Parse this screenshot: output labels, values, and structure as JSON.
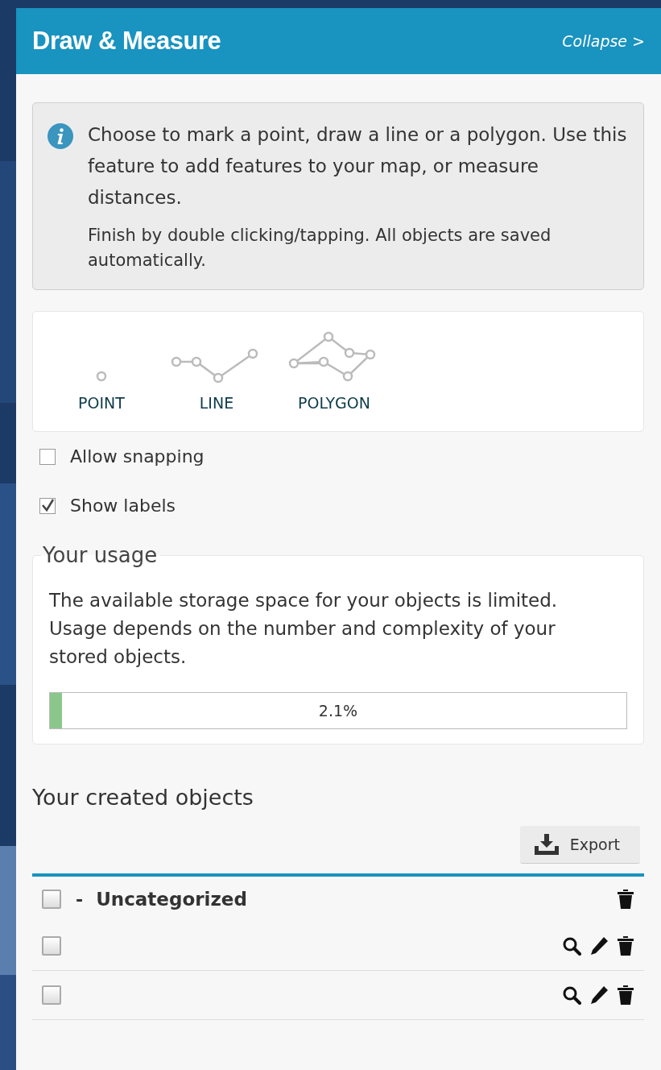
{
  "panel": {
    "title": "Draw & Measure",
    "collapse_link": "Collapse >"
  },
  "info": {
    "paragraphs": [
      "Choose to mark a point, draw a line or a polygon. Use this feature to add features to your map, or measure distances.",
      "Finish by double clicking/tapping. All objects are saved automatically."
    ]
  },
  "tools": [
    {
      "kind": "point",
      "label": "POINT"
    },
    {
      "kind": "line",
      "label": "LINE"
    },
    {
      "kind": "polygon",
      "label": "POLYGON"
    }
  ],
  "options": [
    {
      "label": "Allow snapping",
      "checked": false
    },
    {
      "label": "Show labels",
      "checked": true
    }
  ],
  "usage": {
    "title": "Your usage",
    "text": "The available storage space for your objects is limited. Usage depends on the number and complexity of your stored objects.",
    "level": 0.021,
    "reading": "2.1%"
  },
  "objects": {
    "title": "Your created objects",
    "export_button": "Export",
    "rows": [
      {
        "kind": "category",
        "toggle": "-",
        "label": "Uncategorized",
        "checked": false
      },
      {
        "kind": "object",
        "checked": false
      },
      {
        "kind": "object",
        "checked": false
      }
    ]
  }
}
